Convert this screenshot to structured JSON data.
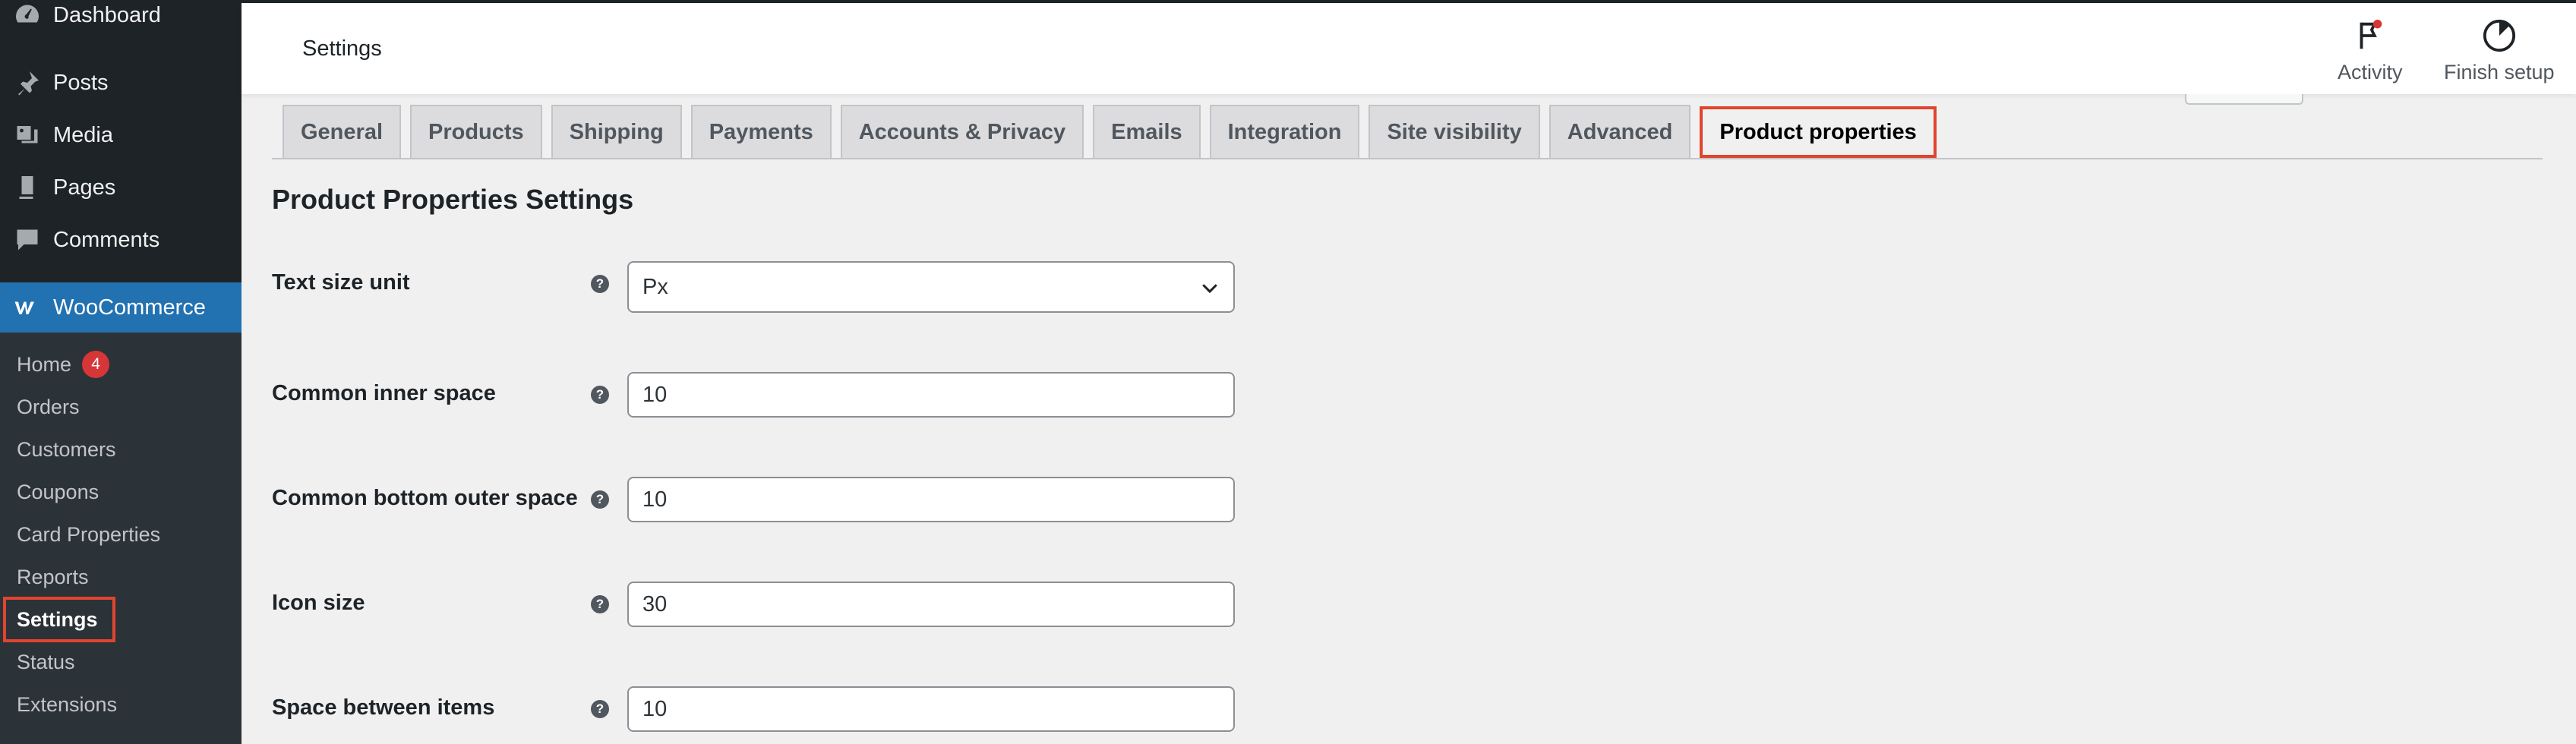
{
  "sidebar": {
    "dashboard": "Dashboard",
    "posts": "Posts",
    "media": "Media",
    "pages": "Pages",
    "comments": "Comments",
    "woocommerce": "WooCommerce",
    "submenu": [
      {
        "label": "Home",
        "badge": "4"
      },
      {
        "label": "Orders"
      },
      {
        "label": "Customers"
      },
      {
        "label": "Coupons"
      },
      {
        "label": "Card Properties"
      },
      {
        "label": "Reports"
      },
      {
        "label": "Settings",
        "active": true
      },
      {
        "label": "Status"
      },
      {
        "label": "Extensions"
      }
    ]
  },
  "header": {
    "title": "Settings",
    "activity": "Activity",
    "finish_setup": "Finish setup"
  },
  "tabs": [
    {
      "label": "General"
    },
    {
      "label": "Products"
    },
    {
      "label": "Shipping"
    },
    {
      "label": "Payments"
    },
    {
      "label": "Accounts & Privacy"
    },
    {
      "label": "Emails"
    },
    {
      "label": "Integration"
    },
    {
      "label": "Site visibility"
    },
    {
      "label": "Advanced"
    },
    {
      "label": "Product properties",
      "active": true
    }
  ],
  "section": {
    "title": "Product Properties Settings",
    "help_glyph": "?",
    "fields": [
      {
        "label": "Text size unit",
        "type": "select",
        "value": "Px"
      },
      {
        "label": "Common inner space",
        "type": "text",
        "value": "10"
      },
      {
        "label": "Common bottom outer space",
        "type": "text",
        "value": "10"
      },
      {
        "label": "Icon size",
        "type": "text",
        "value": "30"
      },
      {
        "label": "Space between items",
        "type": "text",
        "value": "10"
      }
    ]
  },
  "colors": {
    "sidebar_bg": "#1d2327",
    "submenu_bg": "#2c3338",
    "accent": "#2271b1",
    "highlight": "#e0452e",
    "badge": "#d63638"
  },
  "icons": {
    "dashboard": "dashboard-icon",
    "posts": "pin-icon",
    "media": "media-icon",
    "pages": "pages-icon",
    "comments": "comment-icon",
    "woocommerce": "woo-icon",
    "activity": "flag-icon",
    "finish_setup": "progress-icon",
    "help": "help-icon",
    "select": "chevron-down-icon"
  }
}
